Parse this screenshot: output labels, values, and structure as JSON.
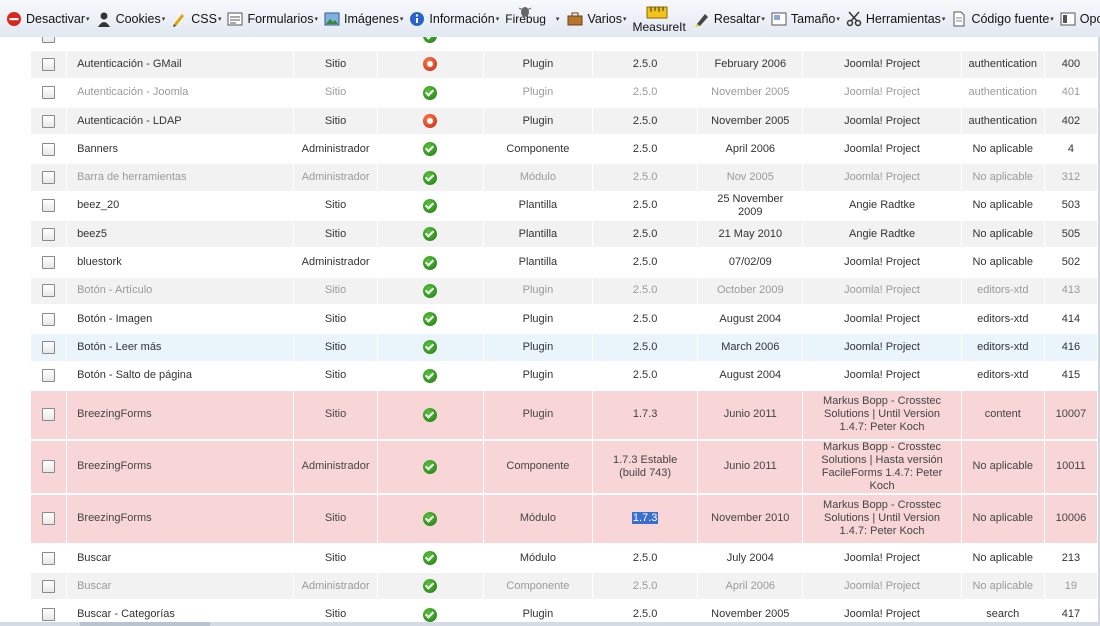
{
  "toolbar": {
    "items": [
      {
        "label": "Desactivar",
        "icon": "no-entry-icon"
      },
      {
        "label": "Cookies",
        "icon": "person-icon"
      },
      {
        "label": "CSS",
        "icon": "pencil-icon"
      },
      {
        "label": "Formularios",
        "icon": "form-icon"
      },
      {
        "label": "Imágenes",
        "icon": "image-icon"
      },
      {
        "label": "Información",
        "icon": "info-icon"
      },
      {
        "label": "Firebug",
        "icon": "firebug-icon"
      },
      {
        "label": "Varios",
        "icon": "briefcase-icon"
      },
      {
        "label": "MeasureIt",
        "icon": "ruler-icon"
      },
      {
        "label": "Resaltar",
        "icon": "highlighter-icon"
      },
      {
        "label": "Tamaño",
        "icon": "resize-icon"
      },
      {
        "label": "Herramientas",
        "icon": "scissors-icon"
      },
      {
        "label": "Código fuente",
        "icon": "document-icon"
      },
      {
        "label": "Opciones",
        "icon": "options-icon"
      }
    ],
    "caret": "▾"
  },
  "rows": [
    {
      "name": "",
      "location": "",
      "state": "ok",
      "type": "",
      "version": "",
      "date": "",
      "author": "",
      "folder": "",
      "id": "",
      "style": "partial"
    },
    {
      "name": "Autenticación - GMail",
      "location": "Sitio",
      "state": "off",
      "type": "Plugin",
      "version": "2.5.0",
      "date": "February 2006",
      "author": "Joomla! Project",
      "folder": "authentication",
      "id": "400",
      "style": "odd"
    },
    {
      "name": "Autenticación - Joomla",
      "location": "Sitio",
      "state": "ok",
      "type": "Plugin",
      "version": "2.5.0",
      "date": "November 2005",
      "author": "Joomla! Project",
      "folder": "authentication",
      "id": "401",
      "style": "even disabled"
    },
    {
      "name": "Autenticación - LDAP",
      "location": "Sitio",
      "state": "off",
      "type": "Plugin",
      "version": "2.5.0",
      "date": "November 2005",
      "author": "Joomla! Project",
      "folder": "authentication",
      "id": "402",
      "style": "odd"
    },
    {
      "name": "Banners",
      "location": "Administrador",
      "state": "ok",
      "type": "Componente",
      "version": "2.5.0",
      "date": "April 2006",
      "author": "Joomla! Project",
      "folder": "No aplicable",
      "id": "4",
      "style": "even"
    },
    {
      "name": "Barra de herramientas",
      "location": "Administrador",
      "state": "ok",
      "type": "Módulo",
      "version": "2.5.0",
      "date": "Nov 2005",
      "author": "Joomla! Project",
      "folder": "No aplicable",
      "id": "312",
      "style": "odd disabled"
    },
    {
      "name": "beez_20",
      "location": "Sitio",
      "state": "ok",
      "type": "Plantilla",
      "version": "2.5.0",
      "date": "25 November 2009",
      "author": "Angie Radtke",
      "folder": "No aplicable",
      "id": "503",
      "style": "even"
    },
    {
      "name": "beez5",
      "location": "Sitio",
      "state": "ok",
      "type": "Plantilla",
      "version": "2.5.0",
      "date": "21 May 2010",
      "author": "Angie Radtke",
      "folder": "No aplicable",
      "id": "505",
      "style": "odd"
    },
    {
      "name": "bluestork",
      "location": "Administrador",
      "state": "ok",
      "type": "Plantilla",
      "version": "2.5.0",
      "date": "07/02/09",
      "author": "Joomla! Project",
      "folder": "No aplicable",
      "id": "502",
      "style": "even"
    },
    {
      "name": "Botón - Artículo",
      "location": "Sitio",
      "state": "ok",
      "type": "Plugin",
      "version": "2.5.0",
      "date": "October 2009",
      "author": "Joomla! Project",
      "folder": "editors-xtd",
      "id": "413",
      "style": "odd disabled"
    },
    {
      "name": "Botón - Imagen",
      "location": "Sitio",
      "state": "ok",
      "type": "Plugin",
      "version": "2.5.0",
      "date": "August 2004",
      "author": "Joomla! Project",
      "folder": "editors-xtd",
      "id": "414",
      "style": "even"
    },
    {
      "name": "Botón - Leer más",
      "location": "Sitio",
      "state": "ok",
      "type": "Plugin",
      "version": "2.5.0",
      "date": "March 2006",
      "author": "Joomla! Project",
      "folder": "editors-xtd",
      "id": "416",
      "style": "hover"
    },
    {
      "name": "Botón - Salto de página",
      "location": "Sitio",
      "state": "ok",
      "type": "Plugin",
      "version": "2.5.0",
      "date": "August 2004",
      "author": "Joomla! Project",
      "folder": "editors-xtd",
      "id": "415",
      "style": "even"
    },
    {
      "name": "BreezingForms",
      "location": "Sitio",
      "state": "ok",
      "type": "Plugin",
      "version": "1.7.3",
      "date": "Junio 2011",
      "author": "Markus Bopp - Crosstec Solutions | Until Version 1.4.7: Peter Koch",
      "folder": "content",
      "id": "10007",
      "style": "hl"
    },
    {
      "name": "BreezingForms",
      "location": "Administrador",
      "state": "ok",
      "type": "Componente",
      "version": "1.7.3 Estable (build 743)",
      "date": "Junio 2011",
      "author": "Markus Bopp - Crosstec Solutions | Hasta versión FacileForms 1.4.7: Peter Koch",
      "folder": "No aplicable",
      "id": "10011",
      "style": "hl h3"
    },
    {
      "name": "BreezingForms",
      "location": "Sitio",
      "state": "ok",
      "type": "Módulo",
      "version": "1.7.3",
      "date": "November 2010",
      "author": "Markus Bopp - Crosstec Solutions | Until Version 1.4.7: Peter Koch",
      "folder": "No aplicable",
      "id": "10006",
      "style": "hl selected"
    },
    {
      "name": "Buscar",
      "location": "Sitio",
      "state": "ok",
      "type": "Módulo",
      "version": "2.5.0",
      "date": "July 2004",
      "author": "Joomla! Project",
      "folder": "No aplicable",
      "id": "213",
      "style": "even"
    },
    {
      "name": "Buscar",
      "location": "Administrador",
      "state": "ok",
      "type": "Componente",
      "version": "2.5.0",
      "date": "April 2006",
      "author": "Joomla! Project",
      "folder": "No aplicable",
      "id": "19",
      "style": "odd disabled"
    },
    {
      "name": "Buscar - Categorías",
      "location": "Sitio",
      "state": "ok",
      "type": "Plugin",
      "version": "2.5.0",
      "date": "November 2005",
      "author": "Joomla! Project",
      "folder": "search",
      "id": "417",
      "style": "even"
    }
  ]
}
